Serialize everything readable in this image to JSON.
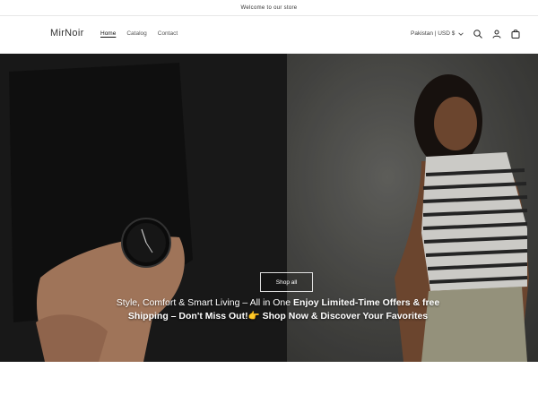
{
  "announcement": {
    "text": "Welcome to our store"
  },
  "header": {
    "logo": "MirNoir",
    "nav": [
      {
        "label": "Home",
        "active": true
      },
      {
        "label": "Catalog",
        "active": false
      },
      {
        "label": "Contact",
        "active": false
      }
    ],
    "locale": "Pakistan | USD $",
    "icons": [
      "search-icon",
      "account-icon",
      "cart-icon"
    ]
  },
  "hero": {
    "button_label": "Shop all",
    "text_part1": "Style, Comfort & Smart Living – All in One ",
    "text_part2": "Enjoy Limited-Time Offers & free Shipping – Don't Miss Out!",
    "emoji": "👉",
    "text_part3": " Shop Now & Discover Your Favorites"
  },
  "colors": {
    "accent": "#121212",
    "background": "#ffffff"
  }
}
